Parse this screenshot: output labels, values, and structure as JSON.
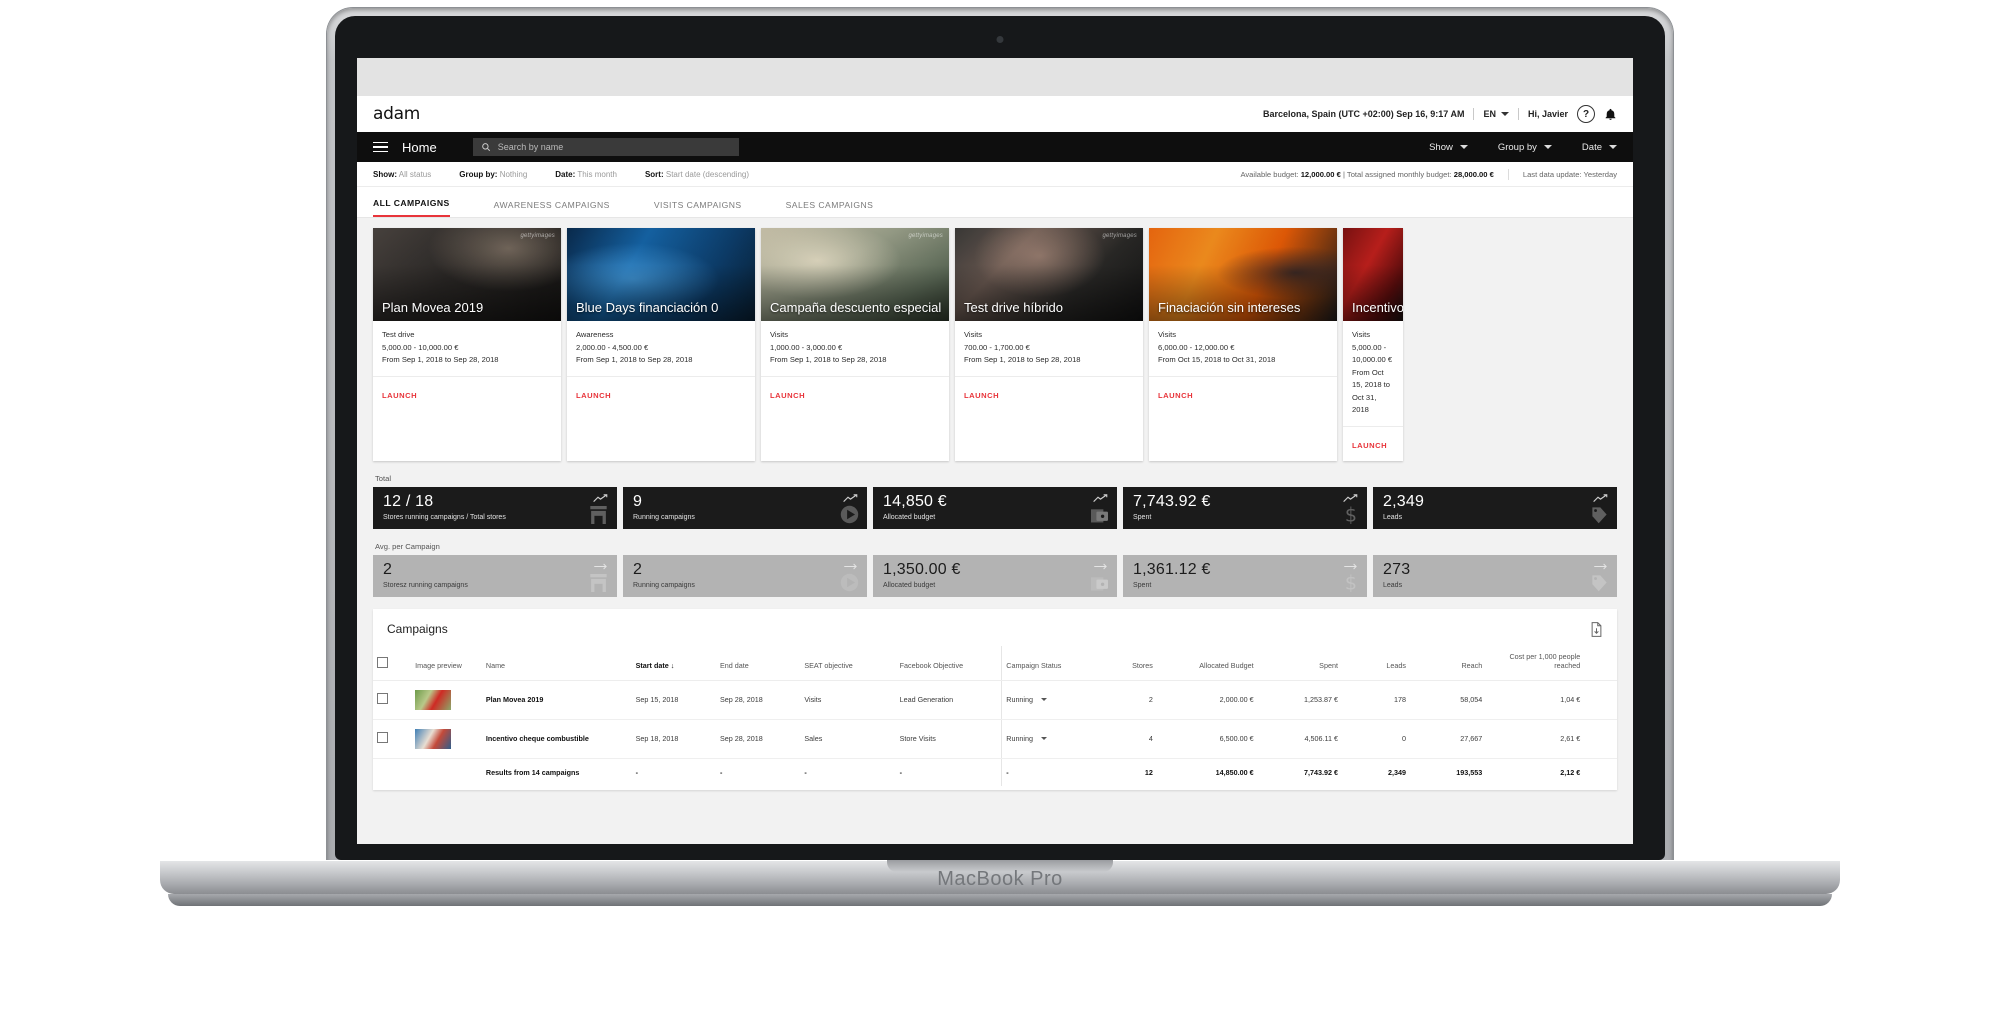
{
  "device": {
    "label": "MacBook Pro"
  },
  "topbar": {
    "logo": "adam",
    "location_time": "Barcelona, Spain (UTC +02:00) Sep 16, 9:17 AM",
    "language": "EN",
    "greeting": "Hi, Javier",
    "help_glyph": "?",
    "bell_glyph": "🔔"
  },
  "nav": {
    "title": "Home",
    "search_placeholder": "Search by name",
    "items": [
      {
        "label": "Show"
      },
      {
        "label": "Group by"
      },
      {
        "label": "Date"
      }
    ]
  },
  "filters": {
    "items": [
      {
        "key": "Show:",
        "value": "All status"
      },
      {
        "key": "Group by:",
        "value": "Nothing"
      },
      {
        "key": "Date:",
        "value": "This month"
      },
      {
        "key": "Sort:",
        "value": "Start date (descending)"
      }
    ],
    "available_budget_label": "Available budget:",
    "available_budget_value": "12,000.00 €",
    "monthly_budget_label": "| Total assigned monthly budget:",
    "monthly_budget_value": "28,000.00 €",
    "last_update": "Last data update: Yesterday"
  },
  "tabs": [
    {
      "label": "ALL CAMPAIGNS",
      "active": true
    },
    {
      "label": "AWARENESS CAMPAIGNS",
      "active": false
    },
    {
      "label": "VISITS CAMPAIGNS",
      "active": false
    },
    {
      "label": "SALES CAMPAIGNS",
      "active": false
    }
  ],
  "cards": [
    {
      "title": "Plan Movea 2019",
      "objective": "Test drive",
      "budget": "5,000.00 - 10,000.00 €",
      "dates": "From Sep 1, 2018 to Sep 28, 2018",
      "action": "LAUNCH",
      "watermark": "gettyimages"
    },
    {
      "title": "Blue Days financiación 0",
      "objective": "Awareness",
      "budget": "2,000.00 - 4,500.00 €",
      "dates": "From Sep 1, 2018 to Sep 28, 2018",
      "action": "LAUNCH",
      "watermark": ""
    },
    {
      "title": "Campaña descuento especial",
      "objective": "Visits",
      "budget": "1,000.00 - 3,000.00 €",
      "dates": "From Sep 1, 2018 to Sep 28, 2018",
      "action": "LAUNCH",
      "watermark": "gettyimages"
    },
    {
      "title": "Test drive híbrido",
      "objective": "Visits",
      "budget": "700.00 - 1,700.00 €",
      "dates": "From Sep 1, 2018 to Sep 28, 2018",
      "action": "LAUNCH",
      "watermark": "gettyimages"
    },
    {
      "title": "Finaciación sin intereses",
      "objective": "Visits",
      "budget": "6,000.00 - 12,000.00 €",
      "dates": "From Oct 15, 2018 to Oct 31, 2018",
      "action": "LAUNCH",
      "watermark": ""
    },
    {
      "title": "Incentivo cheque combustible",
      "objective": "Visits",
      "budget": "5,000.00 - 10,000.00 €",
      "dates": "From Oct 15, 2018 to Oct 31, 2018",
      "action": "LAUNCH",
      "watermark": ""
    }
  ],
  "kpi_total": {
    "group_label": "Total",
    "tiles": [
      {
        "value": "12 / 18",
        "caption": "Stores running campaigns / Total stores",
        "icon": "store-icon",
        "trend": "trend-up-icon"
      },
      {
        "value": "9",
        "caption": "Running campaigns",
        "icon": "play-icon",
        "trend": "trend-up-icon"
      },
      {
        "value": "14,850 €",
        "caption": "Allocated budget",
        "icon": "wallet-icon",
        "trend": "trend-up-icon"
      },
      {
        "value": "7,743.92 €",
        "caption": "Spent",
        "icon": "dollar-icon",
        "trend": "trend-up-icon"
      },
      {
        "value": "2,349",
        "caption": "Leads",
        "icon": "tag-icon",
        "trend": "trend-up-icon"
      }
    ]
  },
  "kpi_avg": {
    "group_label": "Avg. per Campaign",
    "tiles": [
      {
        "value": "2",
        "caption": "Storesz running campaigns",
        "icon": "store-icon",
        "trend": "arrow-right-icon"
      },
      {
        "value": "2",
        "caption": "Running campaigns",
        "icon": "play-icon",
        "trend": "arrow-right-icon"
      },
      {
        "value": "1,350.00 €",
        "caption": "Allocated budget",
        "icon": "wallet-icon",
        "trend": "arrow-right-icon"
      },
      {
        "value": "1,361.12 €",
        "caption": "Spent",
        "icon": "dollar-icon",
        "trend": "arrow-right-icon"
      },
      {
        "value": "273",
        "caption": "Leads",
        "icon": "tag-icon",
        "trend": "arrow-right-icon"
      }
    ]
  },
  "table": {
    "title": "Campaigns",
    "download_icon": "download-document-icon",
    "columns": [
      {
        "label": "",
        "type": "checkbox"
      },
      {
        "label": "Image preview",
        "type": "text"
      },
      {
        "label": "Name",
        "type": "text"
      },
      {
        "label": "Start date",
        "type": "text",
        "sorted": true,
        "sort_dir": "↓"
      },
      {
        "label": "End date",
        "type": "text"
      },
      {
        "label": "SEAT objective",
        "type": "text"
      },
      {
        "label": "Facebook Objective",
        "type": "text"
      },
      {
        "label": "Campaign Status",
        "type": "text"
      },
      {
        "label": "Stores",
        "type": "num"
      },
      {
        "label": "Allocated Budget",
        "type": "num"
      },
      {
        "label": "Spent",
        "type": "num"
      },
      {
        "label": "Leads",
        "type": "num"
      },
      {
        "label": "Reach",
        "type": "num"
      },
      {
        "label": "Cost per 1,000 people reached",
        "type": "num"
      }
    ],
    "rows": [
      {
        "name": "Plan Movea 2019",
        "start": "Sep 15, 2018",
        "end": "Sep 28, 2018",
        "seat": "Visits",
        "fb": "Lead Generation",
        "status": "Running",
        "stores": "2",
        "allocated": "2,000.00 €",
        "spent": "1,253.87 €",
        "leads": "178",
        "reach": "58,054",
        "cpm": "1,04 €"
      },
      {
        "name": "Incentivo cheque combustible",
        "start": "Sep 18, 2018",
        "end": "Sep 28, 2018",
        "seat": "Sales",
        "fb": "Store Visits",
        "status": "Running",
        "stores": "4",
        "allocated": "6,500.00 €",
        "spent": "4,506.11 €",
        "leads": "0",
        "reach": "27,667",
        "cpm": "2,61 €"
      }
    ],
    "total_row": {
      "name": "Results from 14 campaigns",
      "start": "-",
      "end": "-",
      "seat": "-",
      "fb": "-",
      "status": "-",
      "stores": "12",
      "allocated": "14,850.00 €",
      "spent": "7,743.92 €",
      "leads": "2,349",
      "reach": "193,553",
      "cpm": "2,12 €"
    }
  },
  "colors": {
    "accent": "#e8343a",
    "dark_tile": "#1b1b1b",
    "grey_tile": "#b3b3b3",
    "nav_bg": "#0e0e0e"
  }
}
